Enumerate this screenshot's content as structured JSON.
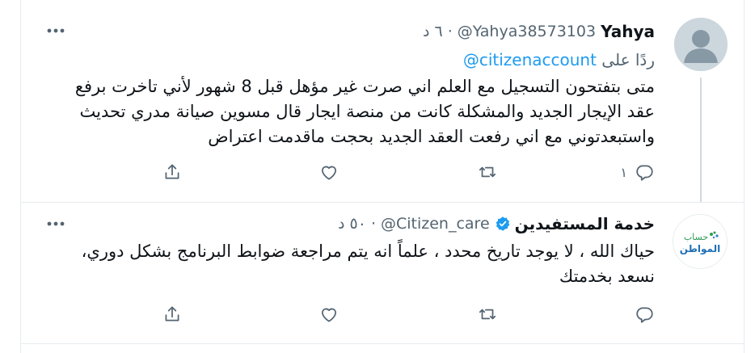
{
  "colors": {
    "text": "#0f1419",
    "muted": "#536471",
    "link": "#1d9bf0",
    "border": "#e6ecf0",
    "thread": "#cfd9de"
  },
  "tweets": [
    {
      "name": "Yahya",
      "handle": "@Yahya38573103",
      "separator": "·",
      "time": "٦ د",
      "reply_prefix": "ردًا على",
      "reply_handle": "@citizenaccount",
      "text": "متى بتفتحون التسجيل مع العلم اني صرت غير مؤهل قبل 8 شهور لأني تاخرت برفع عقد الإيجار الجديد والمشكلة كانت من منصة ايجار قال مسوين صيانة مدري تحديث واستبعدتوني مع اني  رفعت العقد الجديد بحجت ماقدمت اعتراض",
      "reply_count": "١",
      "avatar_icon": "default-user-avatar"
    },
    {
      "name": "خدمة المستفيدين",
      "handle": "@Citizen_care",
      "separator": "·",
      "time": "٥٠ د",
      "verified": true,
      "text_line1": "حياك الله ، لا يوجد تاريخ محدد ، علماً انه يتم مراجعة ضوابط البرنامج بشكل دوري،",
      "text_line2": "نسعد بخدمتك",
      "avatar_icon": "citizen-account-logo",
      "logo_text_top": "حساب",
      "logo_text_bottom": "المواطن"
    }
  ]
}
